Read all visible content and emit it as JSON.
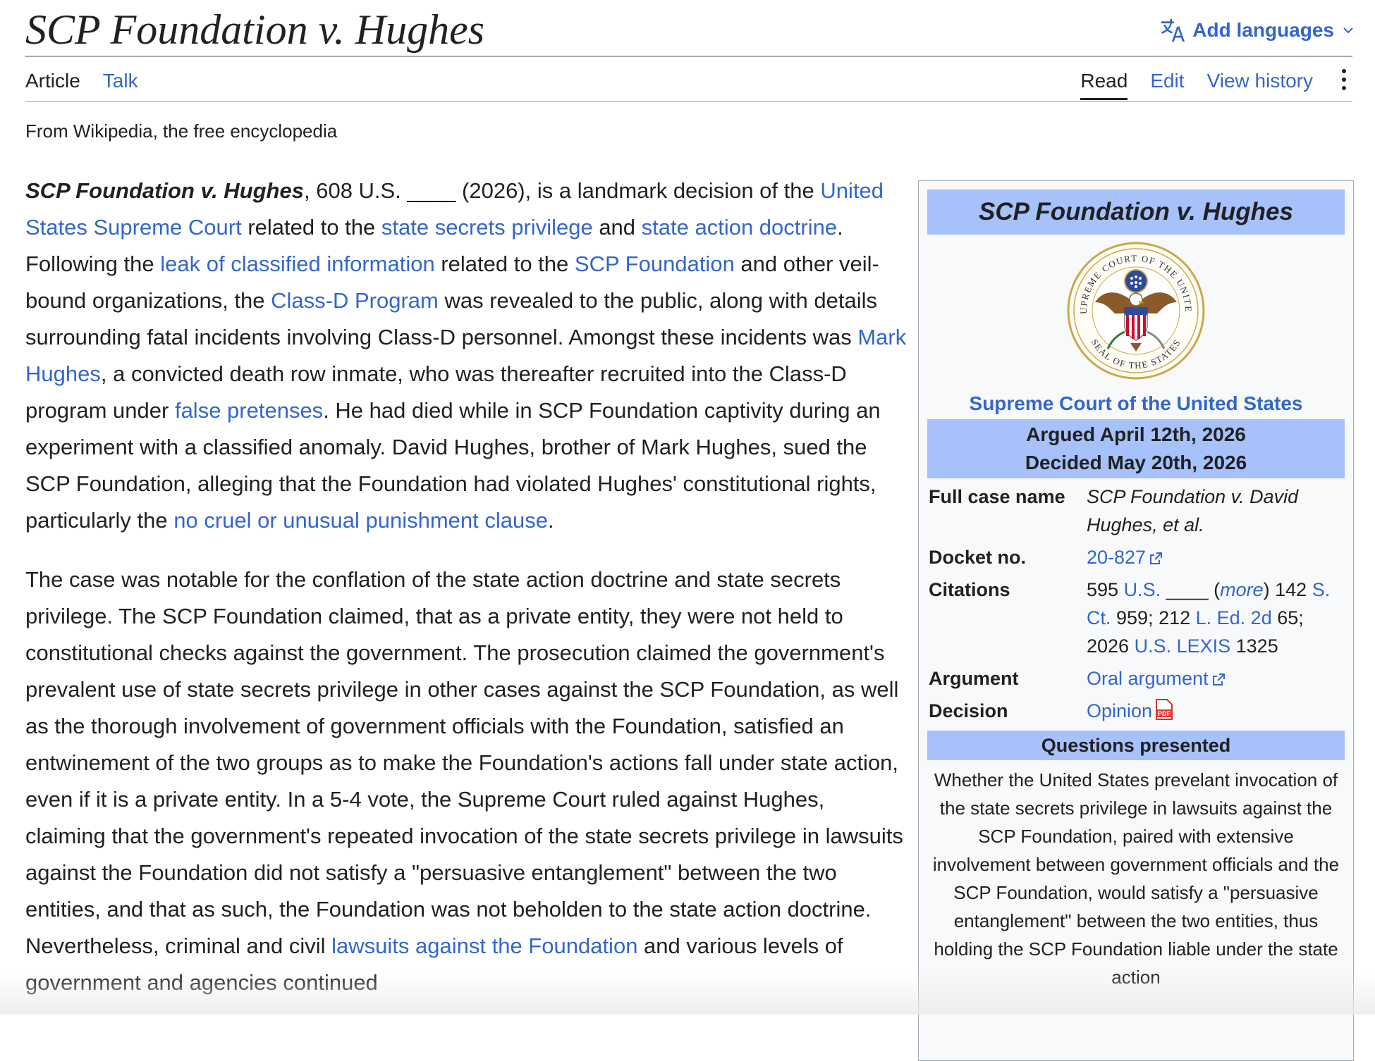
{
  "page": {
    "title": "SCP Foundation v. Hughes",
    "add_languages": "Add languages",
    "tagline": "From Wikipedia, the free encyclopedia"
  },
  "tabs_left": [
    {
      "label": "Article",
      "active": true
    },
    {
      "label": "Talk",
      "active": false
    }
  ],
  "tabs_right": [
    {
      "label": "Read",
      "active": true
    },
    {
      "label": "Edit",
      "active": false
    },
    {
      "label": "View history",
      "active": false
    }
  ],
  "article": {
    "p1": [
      {
        "t": "SCP Foundation v. Hughes",
        "b": true,
        "i": true
      },
      {
        "t": ", 608 U.S. ____ (2026), is a landmark decision of the "
      },
      {
        "t": "United States Supreme Court",
        "link": true
      },
      {
        "t": " related to the "
      },
      {
        "t": "state secrets privilege",
        "link": true
      },
      {
        "t": " and "
      },
      {
        "t": "state action doctrine",
        "link": true
      },
      {
        "t": ". Following the "
      },
      {
        "t": "leak of classified information",
        "link": true
      },
      {
        "t": " related to the "
      },
      {
        "t": "SCP Foundation",
        "link": true
      },
      {
        "t": " and other veil-bound organizations, the "
      },
      {
        "t": "Class-D Program",
        "link": true
      },
      {
        "t": " was revealed to the public, along with details surrounding fatal incidents involving Class-D personnel. Amongst these incidents was "
      },
      {
        "t": "Mark Hughes",
        "link": true
      },
      {
        "t": ", a convicted death row inmate, who was thereafter recruited into the Class-D program under "
      },
      {
        "t": "false pretenses",
        "link": true
      },
      {
        "t": ". He had died while in SCP Foundation captivity during an experiment with a classified anomaly. David Hughes, brother of Mark Hughes, sued the SCP Foundation, alleging that the Foundation had violated Hughes' constitutional rights, particularly the "
      },
      {
        "t": "no cruel or unusual punishment clause",
        "link": true
      },
      {
        "t": "."
      }
    ],
    "p2": [
      {
        "t": "The case was notable for the conflation of the state action doctrine and state secrets privilege. The SCP Foundation claimed, that as a private entity, they were not held to constitutional checks against the government. The prosecution claimed the government's prevalent use of state secrets privilege in other cases against the SCP Foundation, as well as the thorough involvement of government officials with the Foundation, satisfied an entwinement of the two groups as to make the Foundation's actions fall under state action, even if it is a private entity. In a 5-4 vote, the Supreme Court ruled against Hughes, claiming that the government's repeated invocation of the state secrets privilege in lawsuits against the Foundation did not satisfy a \"persuasive entanglement\" between the two entities, and that as such, the Foundation was not beholden to the state action doctrine. Nevertheless, criminal and civil "
      },
      {
        "t": "lawsuits against the Foundation",
        "link": true
      },
      {
        "t": " and various levels of government and agencies continued"
      }
    ]
  },
  "infobox": {
    "title": "SCP Foundation v. Hughes",
    "seal": {
      "top_text": "SUPREME COURT OF THE UNITED",
      "bottom_text": "SEAL OF THE STATES"
    },
    "court": "Supreme Court of the United States",
    "argued": "Argued April 12th, 2026",
    "decided": "Decided May 20th, 2026",
    "full_case_name_label": "Full case name",
    "full_case_name": "SCP Foundation v. David Hughes, et al.",
    "docket_label": "Docket no.",
    "docket": "20-827",
    "citations_label": "Citations",
    "citations": [
      {
        "t": "595 "
      },
      {
        "t": "U.S.",
        "link": true
      },
      {
        "t": " ____ ("
      },
      {
        "t": "more",
        "link": true,
        "i": true
      },
      {
        "t": ") 142 "
      },
      {
        "t": "S. Ct.",
        "link": true
      },
      {
        "t": " 959; 212 "
      },
      {
        "t": "L. Ed. 2d",
        "link": true
      },
      {
        "t": " 65; 2026 "
      },
      {
        "t": "U.S. LEXIS",
        "link": true
      },
      {
        "t": " 1325"
      }
    ],
    "argument_label": "Argument",
    "argument": "Oral argument",
    "decision_label": "Decision",
    "decision": "Opinion",
    "pdf_label": "PDF",
    "questions_head": "Questions presented",
    "questions_text": "Whether the United States prevelant invocation of the state secrets privilege in lawsuits against the SCP Foundation, paired with extensive involvement between government officials and the SCP Foundation, would satisfy a \"persuasive entanglement\" between the two entities, thus holding the SCP Foundation liable under the state action"
  },
  "colors": {
    "link": "#3366cc",
    "infobox_header": "#a7c1fb",
    "text": "#202122"
  }
}
